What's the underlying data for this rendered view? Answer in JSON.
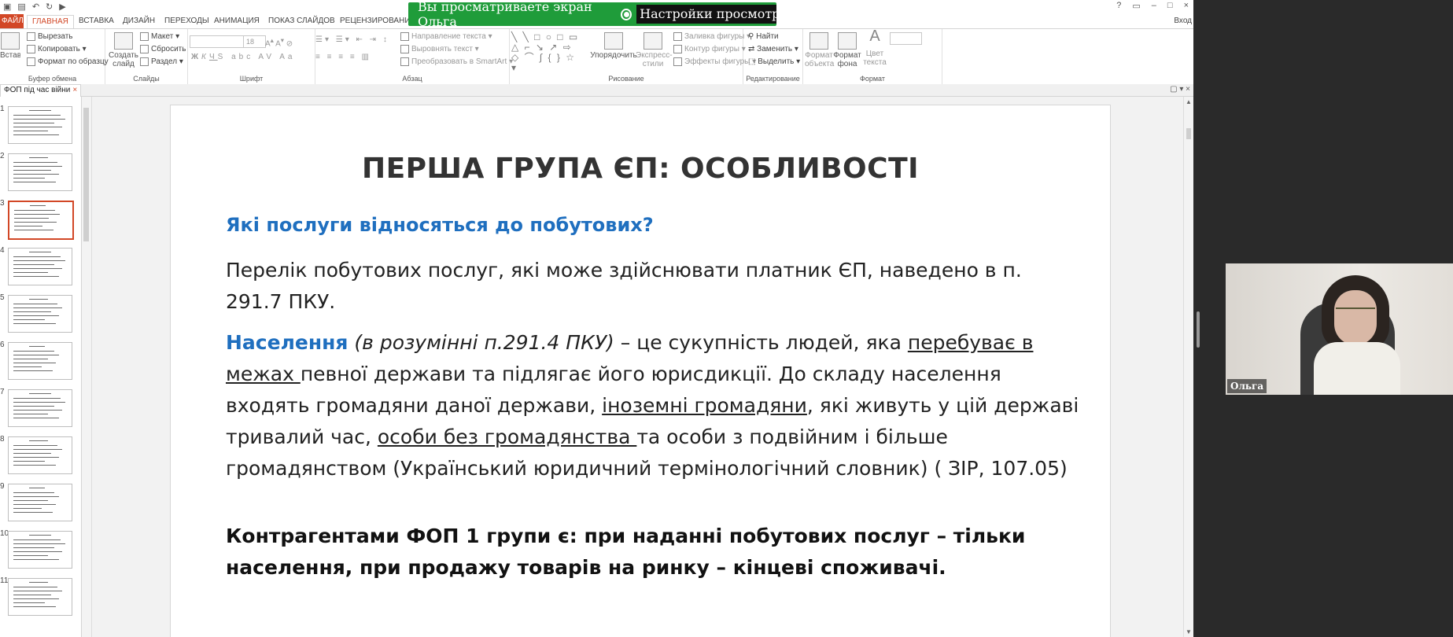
{
  "share_banner": {
    "text": "Вы просматриваете экран Ольга",
    "settings": "Настройки просмотра"
  },
  "titlebar": {
    "controls": [
      "?",
      "▭",
      "–",
      "□",
      "×"
    ]
  },
  "tabs": {
    "file": "ФАЙЛ",
    "items": [
      "ГЛАВНАЯ",
      "ВСТАВКА",
      "ДИЗАЙН",
      "ПЕРЕХОДЫ",
      "АНИМАЦИЯ",
      "ПОКАЗ СЛАЙДОВ",
      "РЕЦЕНЗИРОВАНИЕ"
    ],
    "login": "Вход"
  },
  "ribbon": {
    "clipboard": {
      "label": "Буфер обмена",
      "paste": "Вставить",
      "cut": "Вырезать",
      "copy": "Копировать",
      "format_painter": "Формат по образцу"
    },
    "slides": {
      "label": "Слайды",
      "new_slide": "Создать слайд",
      "layout": "Макет",
      "reset": "Сбросить",
      "section": "Раздел"
    },
    "font": {
      "label": "Шрифт",
      "size": "18"
    },
    "paragraph": {
      "label": "Абзац",
      "text_direction": "Направление текста",
      "align_text": "Выровнять текст",
      "smartart": "Преобразовать в SmartArt"
    },
    "drawing": {
      "label": "Рисование",
      "arrange": "Упорядочить",
      "quick_styles": "Экспресс-стили",
      "shape_fill": "Заливка фигуры",
      "shape_outline": "Контур фигуры",
      "shape_effects": "Эффекты фигуры"
    },
    "editing": {
      "label": "Редактирование",
      "find": "Найти",
      "replace": "Заменить",
      "select": "Выделить"
    },
    "format": {
      "label": "Формат",
      "object_format": "Формат объекта",
      "bg_format": "Формат фона",
      "text_color": "Цвет текста"
    }
  },
  "doc_tab": {
    "title": "ФОП під час війни"
  },
  "thumbnails": {
    "numbers": [
      "1",
      "2",
      "3",
      "4",
      "5",
      "6",
      "7",
      "8",
      "9",
      "10",
      "11"
    ],
    "selected": "3"
  },
  "slide": {
    "title": "ПЕРША ГРУПА ЄП: ОСОБЛИВОСТІ",
    "subtitle": "Які послуги відносяться до побутових?",
    "p1": "Перелік побутових послуг, які може здійснювати платник ЄП, наведено в п. 291.7 ПКУ.",
    "p2_lead": "Населення",
    "p2_italic": " (в розумінні п.291.4 ПКУ)",
    "p2_a": " – це сукупність людей, яка ",
    "p2_u1": "перебуває в межах ",
    "p2_b": "певної держави та підлягає його юрисдикції. До складу населення входять громадяни даної держави, ",
    "p2_u2": "іноземні громадяни",
    "p2_c": ", які живуть у цій державі тривалий час, ",
    "p2_u3": "особи без громадянства ",
    "p2_d": "та особи з подвійним і більше громадянством (Український юридичний термінологічний словник) ( ЗІР, 107.05)",
    "p3": "Контрагентами ФОП 1 групи є: при наданні побутових послуг – тільки населення, при продажу товарів на ринку – кінцеві споживачі."
  },
  "webcam": {
    "name": "Ольга"
  },
  "colors": {
    "accent": "#d24726",
    "share_green": "#1f9c3a",
    "slide_blue": "#1f6fbf"
  }
}
